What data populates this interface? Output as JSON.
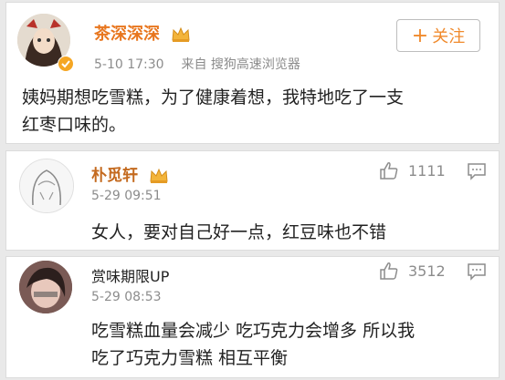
{
  "comments": [
    {
      "user": "茶深深深",
      "time": "5-10 17:30",
      "source": "来自 搜狗高速浏览器",
      "text_lines": [
        "姨妈期想吃雪糕，为了健康着想，我特地吃了一支",
        "红枣口味的。"
      ],
      "follow_label": "关注",
      "follow_symbol": "+"
    },
    {
      "user": "朴觅轩",
      "time": "5-29 09:51",
      "likes": "1111",
      "text_lines": [
        "女人，要对自己好一点，红豆味也不错"
      ]
    },
    {
      "user": "赏味期限UP",
      "time": "5-29 08:53",
      "likes": "3512",
      "text_lines": [
        "吃雪糕血量会减少 吃巧克力会增多 所以我",
        "吃了巧克力雪糕 相互平衡"
      ]
    }
  ],
  "colors": {
    "name_orange": "#e8761e",
    "name_orange_dark": "#c46a1f",
    "follow_text": "#f08a2c",
    "meta_gray": "#8c8c8c"
  },
  "icons": [
    "vip-crown-icon",
    "verified-badge-icon",
    "thumbs-up-icon",
    "comment-icon",
    "plus-icon"
  ]
}
